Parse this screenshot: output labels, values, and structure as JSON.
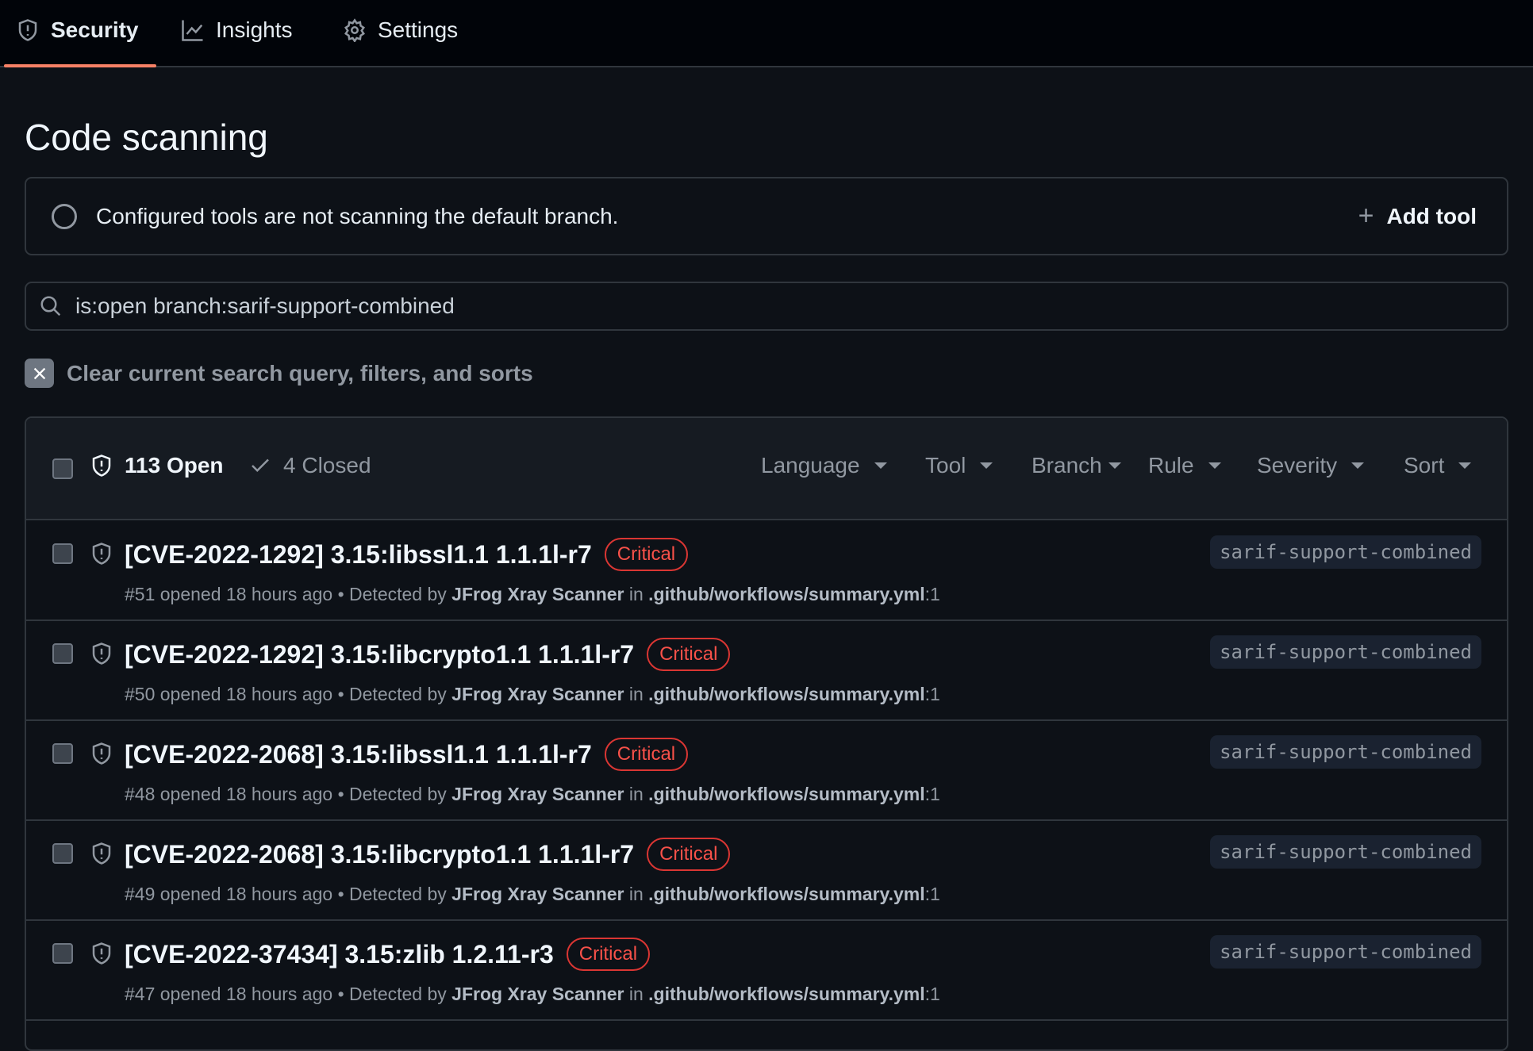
{
  "tabs": [
    {
      "label": "Security",
      "icon": "shield-icon",
      "active": true
    },
    {
      "label": "Insights",
      "icon": "graph-icon"
    },
    {
      "label": "Settings",
      "icon": "gear-icon"
    }
  ],
  "page_title": "Code scanning",
  "notice": {
    "text": "Configured tools are not scanning the default branch.",
    "add_tool": "Add tool"
  },
  "search": {
    "value": "is:open branch:sarif-support-combined"
  },
  "clear_label": "Clear current search query, filters, and sorts",
  "header": {
    "open": "113 Open",
    "closed": "4 Closed",
    "filters": [
      "Language",
      "Tool",
      "Branch",
      "Rule",
      "Severity",
      "Sort"
    ]
  },
  "colors": {
    "accent": "#f78166",
    "critical": "#f85149",
    "background": "#0d1117"
  },
  "alerts": [
    {
      "title": "[CVE-2022-1292] 3.15:libssl1.1 1.1.1l-r7",
      "severity": "Critical",
      "number": "#51",
      "opened": "opened 18 hours ago",
      "detected_by": "Detected by",
      "tool": "JFrog Xray Scanner",
      "in": "in",
      "path": ".github/workflows/summary.yml",
      "line": ":1",
      "branch": "sarif-support-combined"
    },
    {
      "title": "[CVE-2022-1292] 3.15:libcrypto1.1 1.1.1l-r7",
      "severity": "Critical",
      "number": "#50",
      "opened": "opened 18 hours ago",
      "detected_by": "Detected by",
      "tool": "JFrog Xray Scanner",
      "in": "in",
      "path": ".github/workflows/summary.yml",
      "line": ":1",
      "branch": "sarif-support-combined"
    },
    {
      "title": "[CVE-2022-2068] 3.15:libssl1.1 1.1.1l-r7",
      "severity": "Critical",
      "number": "#48",
      "opened": "opened 18 hours ago",
      "detected_by": "Detected by",
      "tool": "JFrog Xray Scanner",
      "in": "in",
      "path": ".github/workflows/summary.yml",
      "line": ":1",
      "branch": "sarif-support-combined"
    },
    {
      "title": "[CVE-2022-2068] 3.15:libcrypto1.1 1.1.1l-r7",
      "severity": "Critical",
      "number": "#49",
      "opened": "opened 18 hours ago",
      "detected_by": "Detected by",
      "tool": "JFrog Xray Scanner",
      "in": "in",
      "path": ".github/workflows/summary.yml",
      "line": ":1",
      "branch": "sarif-support-combined"
    },
    {
      "title": "[CVE-2022-37434] 3.15:zlib 1.2.11-r3",
      "severity": "Critical",
      "number": "#47",
      "opened": "opened 18 hours ago",
      "detected_by": "Detected by",
      "tool": "JFrog Xray Scanner",
      "in": "in",
      "path": ".github/workflows/summary.yml",
      "line": ":1",
      "branch": "sarif-support-combined"
    }
  ]
}
